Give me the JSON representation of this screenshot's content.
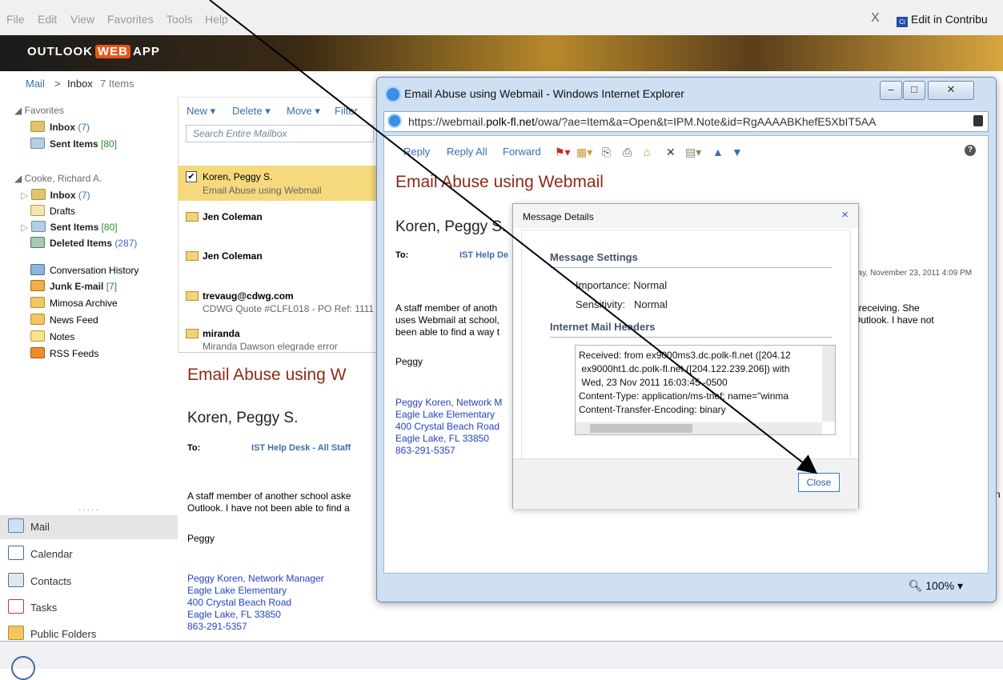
{
  "menubar": {
    "items": [
      "File",
      "Edit",
      "View",
      "Favorites",
      "Tools",
      "Help"
    ],
    "close_x": "X",
    "contribute_label": "Edit in Contribu",
    "contribute_icon_text": "Ci"
  },
  "banner": {
    "logo_pre": "OUTLOOK",
    "logo_web": "WEB",
    "logo_post": "APP"
  },
  "breadcrumb": {
    "root": "Mail",
    "sep": ">",
    "folder": "Inbox",
    "count": "7 Items"
  },
  "nav": {
    "favorites_header": "Favorites",
    "favorites": [
      {
        "label": "Inbox",
        "count": "(7)"
      },
      {
        "label": "Sent Items",
        "count": "[80]"
      }
    ],
    "account_header": "Cooke, Richard A.",
    "folders": [
      {
        "label": "Inbox",
        "count": "(7)"
      },
      {
        "label": "Drafts",
        "count": ""
      },
      {
        "label": "Sent Items",
        "count": "[80]"
      },
      {
        "label": "Deleted Items",
        "count": "(287)"
      },
      {
        "label": "Conversation History",
        "count": ""
      },
      {
        "label": "Junk E-mail",
        "count": "[7]"
      },
      {
        "label": "Mimosa Archive",
        "count": ""
      },
      {
        "label": "News Feed",
        "count": ""
      },
      {
        "label": "Notes",
        "count": ""
      },
      {
        "label": "RSS Feeds",
        "count": ""
      }
    ],
    "dots": ".....",
    "modules": [
      "Mail",
      "Calendar",
      "Contacts",
      "Tasks",
      "Public Folders"
    ]
  },
  "toolbar": {
    "new": "New ▾",
    "delete": "Delete ▾",
    "move": "Move ▾",
    "filter": "Filter",
    "search_placeholder": "Search Entire Mailbox"
  },
  "messages": [
    {
      "from": "Koren, Peggy S.",
      "subject": "Email Abuse using Webmail"
    },
    {
      "from": "Jen Coleman",
      "subject": ""
    },
    {
      "from": "Jen Coleman",
      "subject": ""
    },
    {
      "from": "trevaug@cdwg.com",
      "subject": "CDWG Quote #CLFL018 - PO Ref: 1111"
    },
    {
      "from": "miranda",
      "subject": "Miranda Dawson elegrade error"
    }
  ],
  "reading": {
    "title": "Email Abuse using W",
    "from": "Koren, Peggy S.",
    "to_label": "To:",
    "to_value": "IST Help Desk - All Staff",
    "body_line1": "A staff member of another school aske",
    "body_line2": "Outlook. I have not been able to find a",
    "sign": "Peggy",
    "sig": [
      "Peggy Koren, Network Manager",
      "Eagle Lake Elementary",
      "400 Crystal Beach Road",
      "Eagle Lake, FL 33850",
      "863-291-5357"
    ]
  },
  "ie": {
    "title": "Email Abuse using Webmail - Windows Internet Explorer",
    "url_pre": "https://webmail.",
    "url_domain": "polk-fl.net",
    "url_post": "/owa/?ae=Item&a=Open&t=IPM.Note&id=RgAAAABKhefE5XbIT5AA",
    "toolbar": {
      "reply": "Reply",
      "reply_all": "Reply All",
      "forward": "Forward"
    },
    "help": "?",
    "zoom": "100%",
    "msg": {
      "title": "Email Abuse using Webmail",
      "from": "Koren, Peggy S.",
      "to_label": "To:",
      "to_value": "IST Help De",
      "date": "day, November 23, 2011 4:09 PM",
      "body_left": "A staff member of anoth\nuses Webmail at school,\nbeen able to find a way t",
      "body_right": "en receiving. She\ne Outlook. I have not",
      "sign": "Peggy",
      "sig": "Peggy Koren, Network M\nEagle Lake Elementary\n400 Crystal Beach Road\nEagle Lake, FL 33850\n863-291-5357"
    }
  },
  "dialog": {
    "title": "Message Details",
    "close_x": "×",
    "settings_header": "Message Settings",
    "importance_label": "Importance:",
    "importance_value": "Normal",
    "sensitivity_label": "Sensitivity:",
    "sensitivity_value": "Normal",
    "headers_header": "Internet Mail Headers",
    "headers_text": "Received: from ex9000ms3.dc.polk-fl.net ([204.12\n ex9000ht1.dc.polk-fl.net ([204.122.239.206]) with\n Wed, 23 Nov 2011 16:03:45 -0500\nContent-Type: application/ms-tnef; name=\"winma\nContent-Transfer-Encoding: binary",
    "close_button": "Close"
  },
  "outer_right_text": "n",
  "colors": {
    "accent": "#3b6db3",
    "title": "#8b2b1a",
    "selected": "#f5d97c",
    "signature": "#2442c4"
  }
}
